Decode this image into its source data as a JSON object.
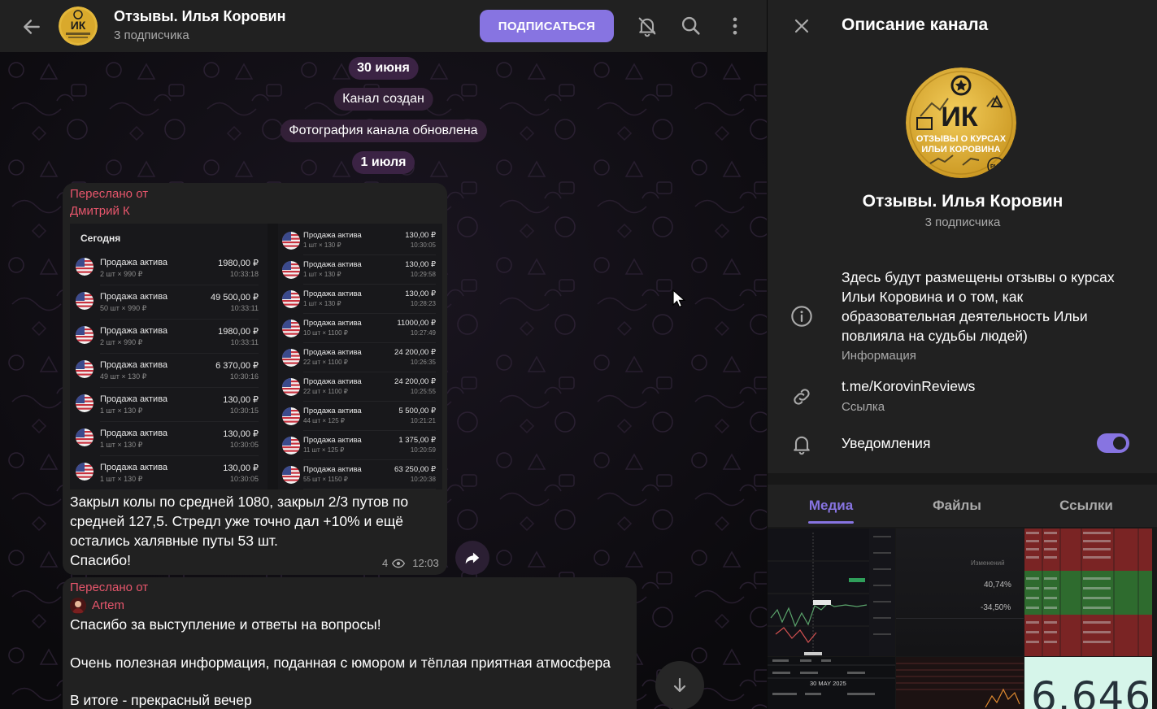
{
  "header": {
    "title": "Отзывы. Илья Коровин",
    "subtitle": "3 подписчика",
    "subscribe_label": "ПОДПИСАТЬСЯ",
    "avatar_text": "ИК"
  },
  "service_messages": {
    "date1": "30 июня",
    "created": "Канал создан",
    "photo_updated": "Фотография канала обновлена",
    "date2": "1 июля"
  },
  "message1": {
    "forwarded_label": "Переслано от",
    "forwarded_name": "Дмитрий К",
    "screenshot": {
      "today_label": "Сегодня",
      "left_rows": [
        {
          "title": "Продажа актива",
          "sub": "2 шт × 990 ₽",
          "amount": "1980,00 ₽",
          "time": "10:33:18"
        },
        {
          "title": "Продажа актива",
          "sub": "50 шт × 990 ₽",
          "amount": "49 500,00 ₽",
          "time": "10:33:11"
        },
        {
          "title": "Продажа актива",
          "sub": "2 шт × 990 ₽",
          "amount": "1980,00 ₽",
          "time": "10:33:11"
        },
        {
          "title": "Продажа актива",
          "sub": "49 шт × 130 ₽",
          "amount": "6 370,00 ₽",
          "time": "10:30:16"
        },
        {
          "title": "Продажа актива",
          "sub": "1 шт × 130 ₽",
          "amount": "130,00 ₽",
          "time": "10:30:15"
        },
        {
          "title": "Продажа актива",
          "sub": "1 шт × 130 ₽",
          "amount": "130,00 ₽",
          "time": "10:30:05"
        },
        {
          "title": "Продажа актива",
          "sub": "1 шт × 130 ₽",
          "amount": "130,00 ₽",
          "time": "10:30:05"
        }
      ],
      "right_rows": [
        {
          "title": "Продажа актива",
          "sub": "1 шт × 130 ₽",
          "amount": "130,00 ₽",
          "time": "10:30:05"
        },
        {
          "title": "Продажа актива",
          "sub": "1 шт × 130 ₽",
          "amount": "130,00 ₽",
          "time": "10:29:58"
        },
        {
          "title": "Продажа актива",
          "sub": "1 шт × 130 ₽",
          "amount": "130,00 ₽",
          "time": "10:28:23"
        },
        {
          "title": "Продажа актива",
          "sub": "10 шт × 1100 ₽",
          "amount": "11000,00 ₽",
          "time": "10:27:49"
        },
        {
          "title": "Продажа актива",
          "sub": "22 шт × 1100 ₽",
          "amount": "24 200,00 ₽",
          "time": "10:26:35"
        },
        {
          "title": "Продажа актива",
          "sub": "22 шт × 1100 ₽",
          "amount": "24 200,00 ₽",
          "time": "10:25:55"
        },
        {
          "title": "Продажа актива",
          "sub": "44 шт × 125 ₽",
          "amount": "5 500,00 ₽",
          "time": "10:21:21"
        },
        {
          "title": "Продажа актива",
          "sub": "11 шт × 125 ₽",
          "amount": "1 375,00 ₽",
          "time": "10:20:59"
        },
        {
          "title": "Продажа актива",
          "sub": "55 шт × 1150 ₽",
          "amount": "63 250,00 ₽",
          "time": "10:20:38"
        }
      ]
    },
    "text_lines": [
      "Закрыл колы по средней 1080, закрыл 2/3 путов по",
      "средней 127,5. Стредл уже точно дал +10% и ещё",
      "остались халявные путы 53 шт.",
      "Спасибо!"
    ],
    "views": "4",
    "time": "12:03"
  },
  "message2": {
    "forwarded_label": "Переслано от",
    "forwarded_name": "Artem",
    "line1": "Спасибо за выступление и ответы на вопросы!",
    "line2": "Очень полезная информация, поданная с юмором и тёплая приятная атмосфера",
    "line3": "В итоге - прекрасный вечер"
  },
  "panel": {
    "title": "Описание канала",
    "avatar": {
      "letters": "ИК",
      "line1": "ОТЗЫВЫ О КУРСАХ",
      "line2": "ИЛЬИ КОРОВИНА",
      "badge": "PUT"
    },
    "channel_name": "Отзывы. Илья Коровин",
    "channel_subs": "3 подписчика",
    "description_lines": [
      "Здесь будут размещены отзывы о курсах",
      "Ильи Коровина и о том, как",
      "образовательная деятельность Ильи",
      "повлияла на судьбы людей)"
    ],
    "description_caption": "Информация",
    "link": "t.me/KorovinReviews",
    "link_caption": "Ссылка",
    "notifications_label": "Уведомления",
    "notifications_on": true,
    "tabs": [
      "Медиа",
      "Файлы",
      "Ссылки"
    ],
    "media": {
      "thumb2_pct1": "40,74%",
      "thumb2_pct2": "-34,50%",
      "thumb2_label": "Изменений",
      "thumb4_date": "30 MAY 2025",
      "thumb6_number": "6.646"
    }
  },
  "colors": {
    "accent": "#8774e1",
    "forward": "#e7566c",
    "bubble": "#212121",
    "service": "#3b2344"
  }
}
